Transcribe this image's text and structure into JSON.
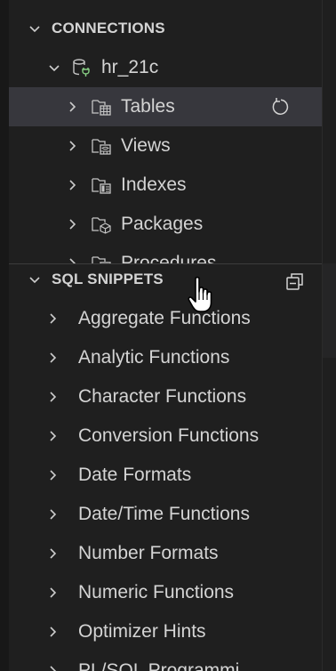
{
  "connections": {
    "header": "CONNECTIONS",
    "connection": {
      "name": "hr_21c",
      "icon": "database-connection-icon"
    },
    "children": [
      {
        "label": "Tables",
        "icon": "table-folder-icon",
        "selected": true
      },
      {
        "label": "Views",
        "icon": "view-folder-icon"
      },
      {
        "label": "Indexes",
        "icon": "index-folder-icon"
      },
      {
        "label": "Packages",
        "icon": "package-folder-icon"
      },
      {
        "label": "Procedures",
        "icon": "procedure-folder-icon"
      }
    ],
    "refresh_icon": "refresh-icon"
  },
  "snippets": {
    "header": "SQL SNIPPETS",
    "collapse_icon": "collapse-all-icon",
    "items": [
      {
        "label": "Aggregate Functions"
      },
      {
        "label": "Analytic Functions"
      },
      {
        "label": "Character Functions"
      },
      {
        "label": "Conversion Functions"
      },
      {
        "label": "Date Formats"
      },
      {
        "label": "Date/Time Functions"
      },
      {
        "label": "Number Formats"
      },
      {
        "label": "Numeric Functions"
      },
      {
        "label": "Optimizer Hints"
      },
      {
        "label": "PL/SQL Programmi"
      }
    ]
  },
  "colors": {
    "background": "#1f1f1f",
    "selected_row": "#37373d",
    "text": "#d4d4d4",
    "db_icon_accent": "#89d185"
  }
}
